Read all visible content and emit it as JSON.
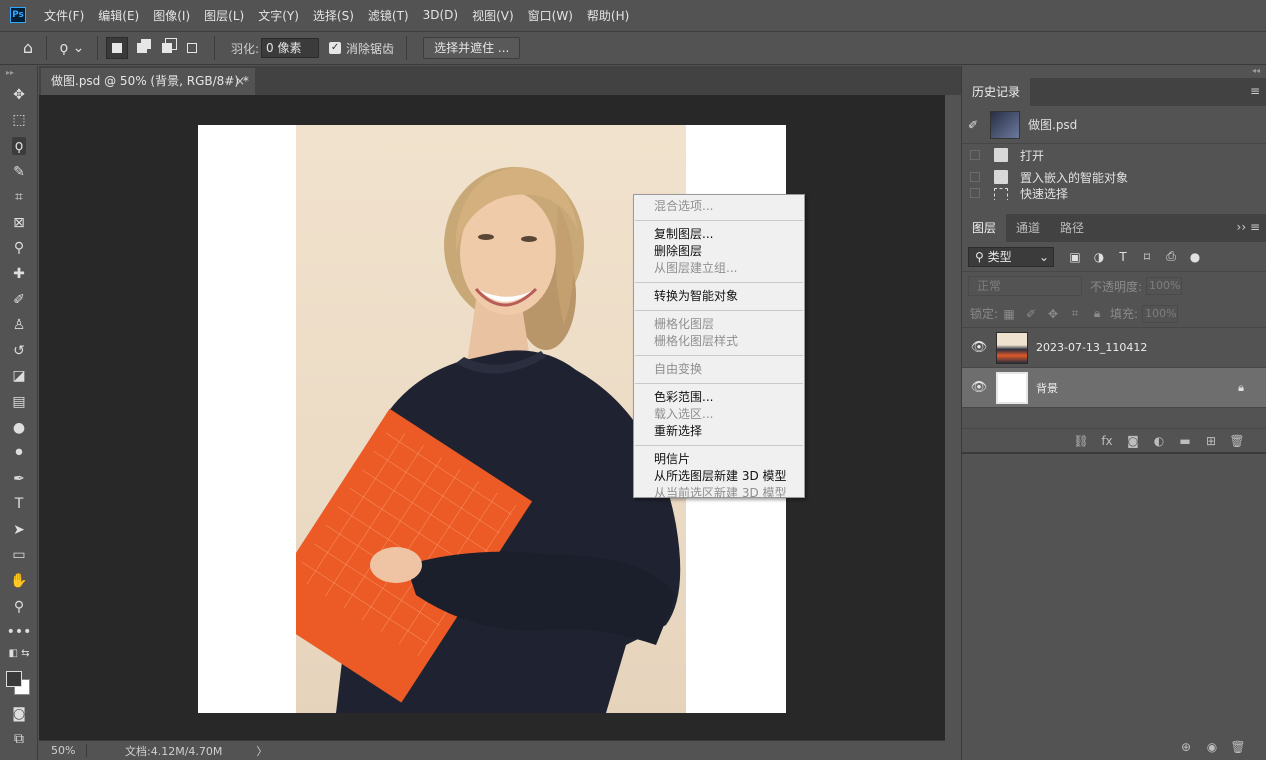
{
  "app": {
    "logo": "Ps"
  },
  "menu": [
    "文件(F)",
    "编辑(E)",
    "图像(I)",
    "图层(L)",
    "文字(Y)",
    "选择(S)",
    "滤镜(T)",
    "3D(D)",
    "视图(V)",
    "窗口(W)",
    "帮助(H)"
  ],
  "options": {
    "home_icon": "⌂",
    "lasso_icon": "ϙ ⌄",
    "feather_label": "羽化:",
    "feather_value": "0 像素",
    "antialias_check": "✓",
    "antialias_label": "消除锯齿",
    "select_mask_label": "选择并遮住 ..."
  },
  "tools": [
    {
      "name": "move-tool-icon",
      "glyph": "✥"
    },
    {
      "name": "marquee-tool-icon",
      "glyph": "⬚"
    },
    {
      "name": "lasso-tool-icon",
      "glyph": "ϙ"
    },
    {
      "name": "quick-select-tool-icon",
      "glyph": "✎"
    },
    {
      "name": "crop-tool-icon",
      "glyph": "⌗"
    },
    {
      "name": "frame-tool-icon",
      "glyph": "⊠"
    },
    {
      "name": "eyedropper-tool-icon",
      "glyph": "⚲"
    },
    {
      "name": "healing-brush-tool-icon",
      "glyph": "✚"
    },
    {
      "name": "brush-tool-icon",
      "glyph": "✐"
    },
    {
      "name": "clone-stamp-tool-icon",
      "glyph": "♙"
    },
    {
      "name": "history-brush-tool-icon",
      "glyph": "↺"
    },
    {
      "name": "eraser-tool-icon",
      "glyph": "◪"
    },
    {
      "name": "gradient-tool-icon",
      "glyph": "▤"
    },
    {
      "name": "blur-tool-icon",
      "glyph": "●"
    },
    {
      "name": "dodge-tool-icon",
      "glyph": "⚫"
    },
    {
      "name": "pen-tool-icon",
      "glyph": "✒"
    },
    {
      "name": "type-tool-icon",
      "glyph": "T"
    },
    {
      "name": "path-select-tool-icon",
      "glyph": "➤"
    },
    {
      "name": "rectangle-tool-icon",
      "glyph": "▭"
    },
    {
      "name": "hand-tool-icon",
      "glyph": "✋"
    },
    {
      "name": "zoom-tool-icon",
      "glyph": "⚲"
    },
    {
      "name": "more-tools-icon",
      "glyph": "•••"
    }
  ],
  "document": {
    "tab_title": "做图.psd @ 50% (背景, RGB/8#) *",
    "tab_close": "×"
  },
  "context_menu": {
    "items": [
      {
        "label": "混合选项...",
        "enabled": false
      },
      {
        "sep": true
      },
      {
        "label": "复制图层...",
        "enabled": true
      },
      {
        "label": "删除图层",
        "enabled": true
      },
      {
        "label": "从图层建立组...",
        "enabled": false
      },
      {
        "sep": true
      },
      {
        "label": "转换为智能对象",
        "enabled": true
      },
      {
        "sep": true
      },
      {
        "label": "栅格化图层",
        "enabled": false
      },
      {
        "label": "栅格化图层样式",
        "enabled": false
      },
      {
        "sep": true
      },
      {
        "label": "自由变换",
        "enabled": false
      },
      {
        "sep": true
      },
      {
        "label": "色彩范围...",
        "enabled": true
      },
      {
        "label": "载入选区...",
        "enabled": false
      },
      {
        "label": "重新选择",
        "enabled": true
      },
      {
        "sep": true
      },
      {
        "label": "明信片",
        "enabled": true
      },
      {
        "label": "从所选图层新建 3D 模型",
        "enabled": true
      },
      {
        "label": "从当前选区新建 3D 模型",
        "enabled": false
      }
    ]
  },
  "status": {
    "zoom": "50%",
    "doc_info": "文档:4.12M/4.70M",
    "arrow": "〉"
  },
  "history_panel": {
    "tab": "历史记录",
    "snapshot_name": "做图.psd",
    "steps": [
      "打开",
      "置入嵌入的智能对象",
      "快速选择"
    ]
  },
  "layers_panel": {
    "tabs": [
      "图层",
      "通道",
      "路径"
    ],
    "kind_label": "⚲ 类型",
    "kind_arrow": "⌄",
    "blend_mode": "正常",
    "opacity_label": "不透明度:",
    "opacity_value": "100%",
    "lock_label": "锁定:",
    "fill_label": "填充:",
    "fill_value": "100%",
    "layers": [
      {
        "name": "2023-07-13_110412",
        "selected": false,
        "locked": false
      },
      {
        "name": "背景",
        "selected": true,
        "locked": true
      }
    ]
  }
}
